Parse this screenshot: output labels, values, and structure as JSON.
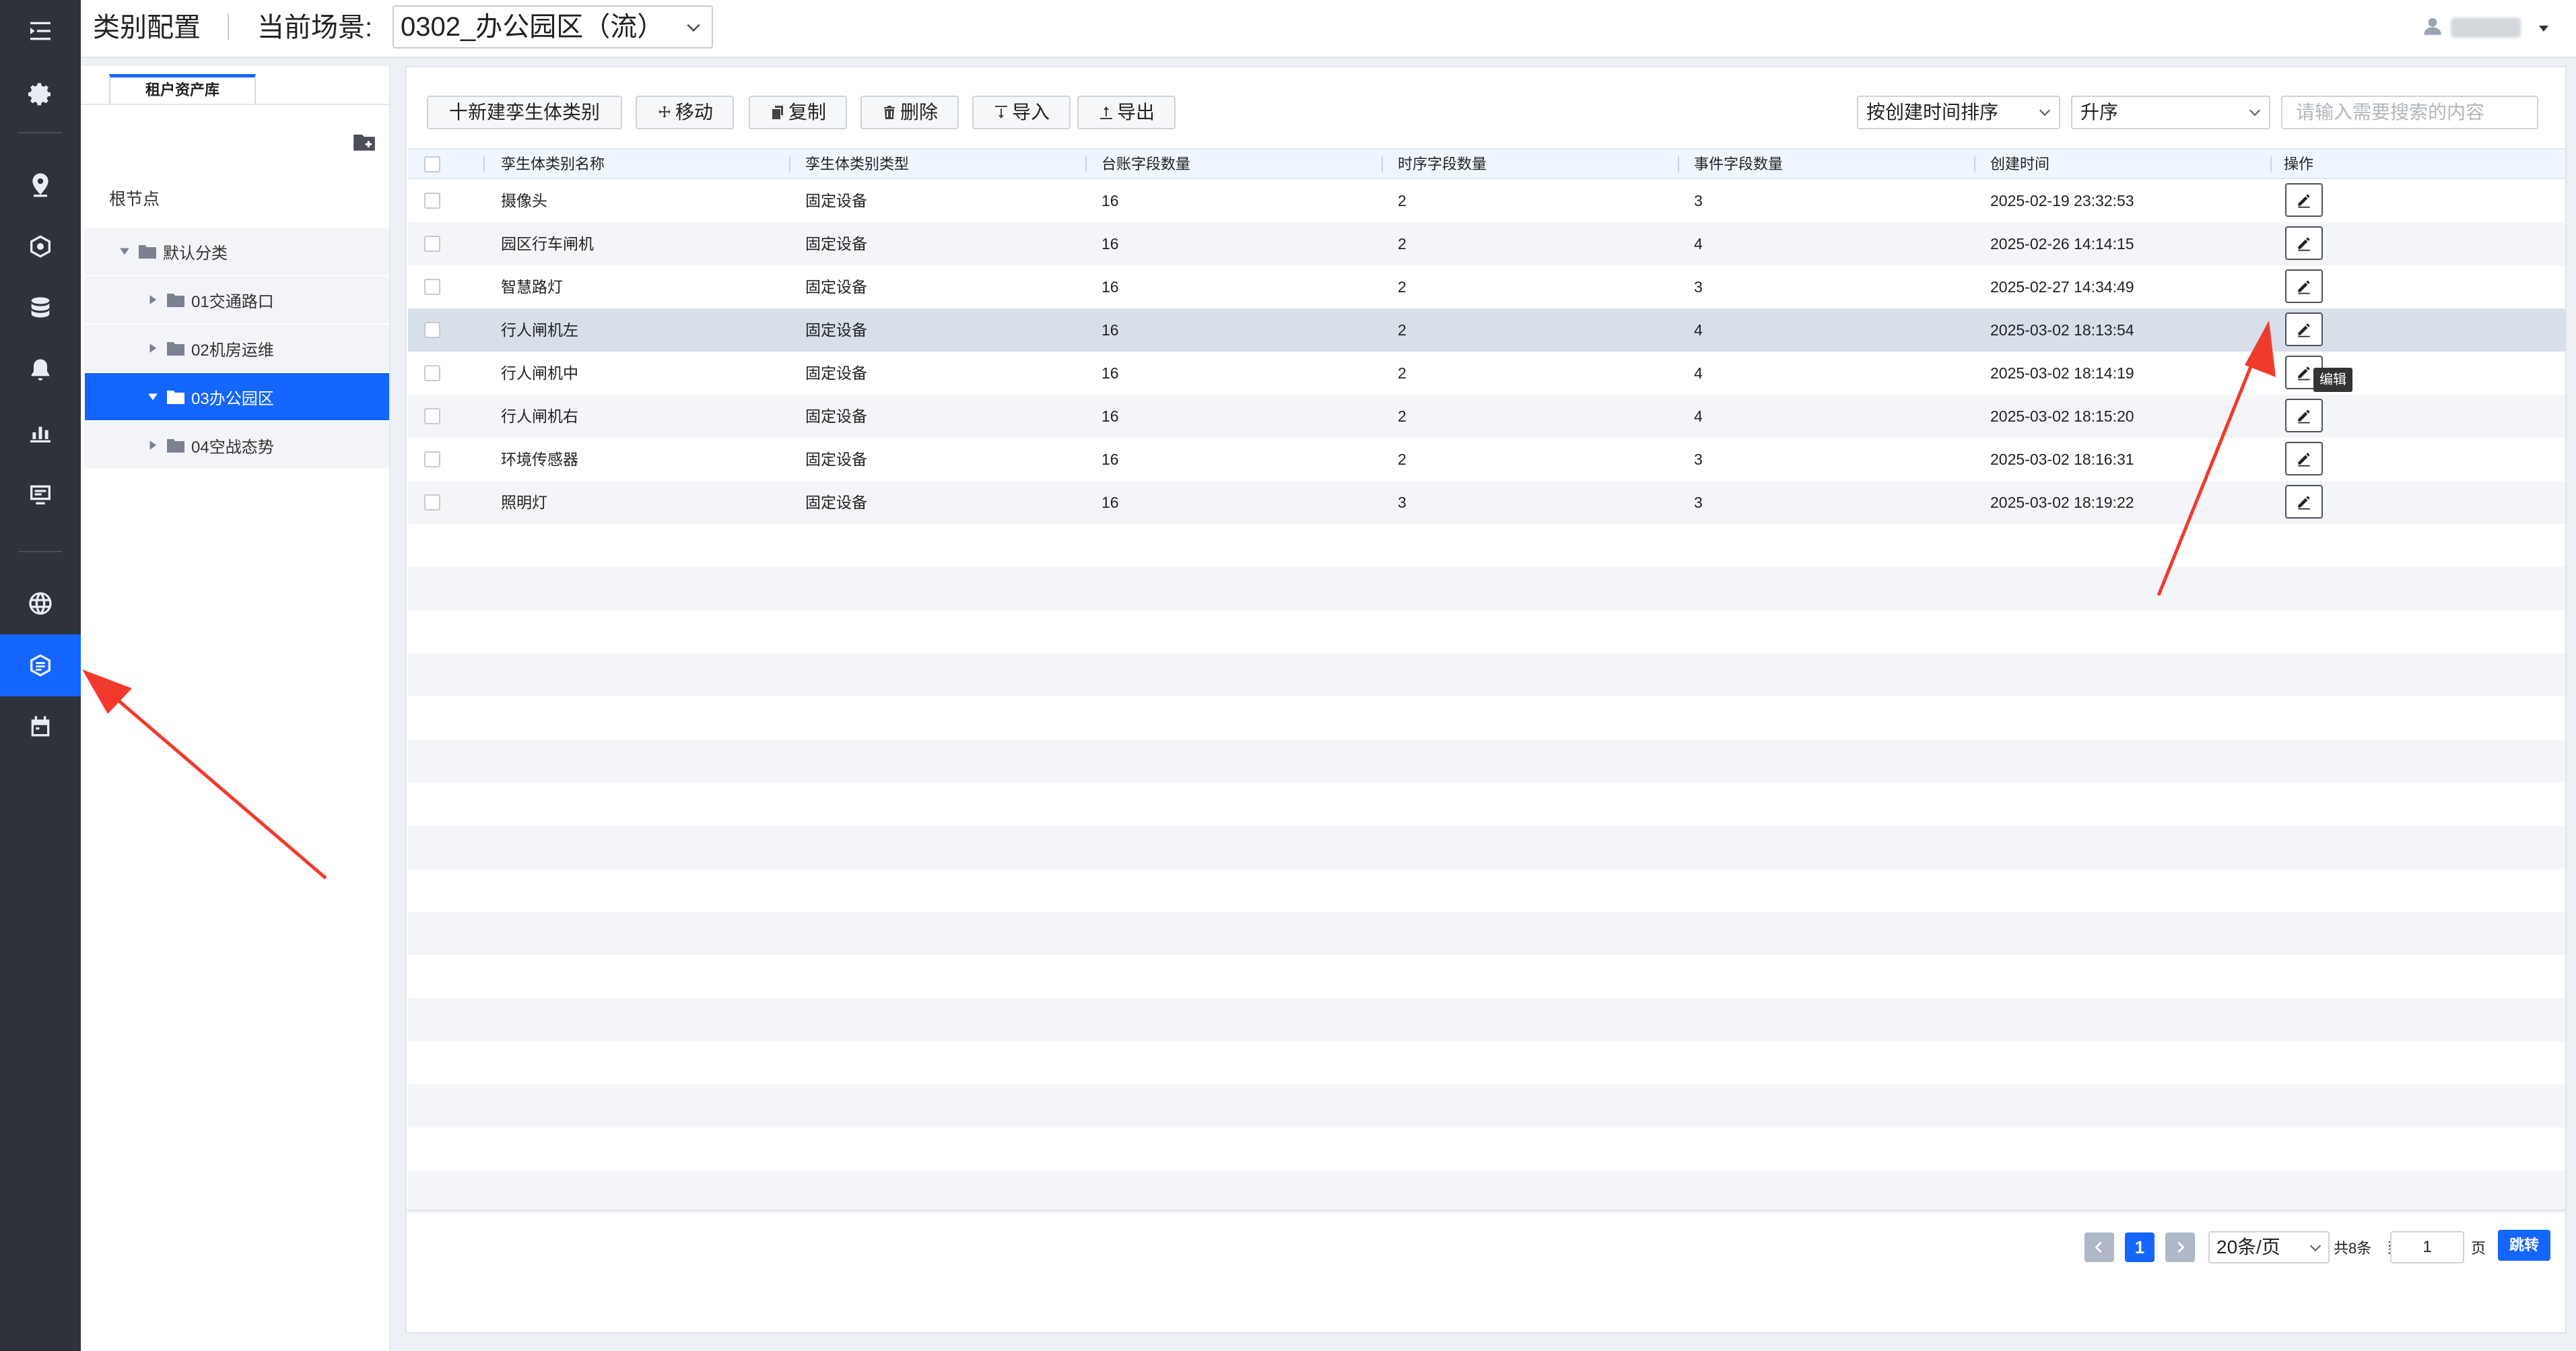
{
  "header": {
    "page_title": "类别配置",
    "scene_label": "当前场景:",
    "scene_value": "0302_办公园区（流）"
  },
  "sidebar": {
    "icons": [
      "menu-toggle-icon",
      "gear-icon",
      "location-pin-icon",
      "cube-gear-icon",
      "database-icon",
      "bell-icon",
      "bar-chart-icon",
      "monitor-icon",
      "globe-icon",
      "category-config-icon",
      "calendar-icon"
    ],
    "active": "category-config-icon"
  },
  "tree": {
    "tab": "租户资产库",
    "root": "根节点",
    "nodes": [
      {
        "label": "默认分类",
        "expanded": true
      },
      {
        "label": "01交通路口",
        "expanded": false
      },
      {
        "label": "02机房运维",
        "expanded": false
      },
      {
        "label": "03办公园区",
        "expanded": true,
        "selected": true
      },
      {
        "label": "04空战态势",
        "expanded": false
      }
    ]
  },
  "toolbar": {
    "new_label": "十新建孪生体类别",
    "move_label": "移动",
    "copy_label": "复制",
    "delete_label": "删除",
    "import_label": "导入",
    "export_label": "导出",
    "sort_value": "按创建时间排序",
    "order_value": "升序",
    "search_placeholder": "请输入需要搜索的内容"
  },
  "table": {
    "headers": [
      "孪生体类别名称",
      "孪生体类别类型",
      "台账字段数量",
      "时序字段数量",
      "事件字段数量",
      "创建时间",
      "操作"
    ],
    "rows": [
      {
        "name": "摄像头",
        "type": "固定设备",
        "ledger": "16",
        "timeseries": "2",
        "event": "3",
        "created": "2025-02-19 23:32:53"
      },
      {
        "name": "园区行车闸机",
        "type": "固定设备",
        "ledger": "16",
        "timeseries": "2",
        "event": "4",
        "created": "2025-02-26 14:14:15"
      },
      {
        "name": "智慧路灯",
        "type": "固定设备",
        "ledger": "16",
        "timeseries": "2",
        "event": "3",
        "created": "2025-02-27 14:34:49"
      },
      {
        "name": "行人闸机左",
        "type": "固定设备",
        "ledger": "16",
        "timeseries": "2",
        "event": "4",
        "created": "2025-03-02 18:13:54"
      },
      {
        "name": "行人闸机中",
        "type": "固定设备",
        "ledger": "16",
        "timeseries": "2",
        "event": "4",
        "created": "2025-03-02 18:14:19"
      },
      {
        "name": "行人闸机右",
        "type": "固定设备",
        "ledger": "16",
        "timeseries": "2",
        "event": "4",
        "created": "2025-03-02 18:15:20"
      },
      {
        "name": "环境传感器",
        "type": "固定设备",
        "ledger": "16",
        "timeseries": "2",
        "event": "3",
        "created": "2025-03-02 18:16:31"
      },
      {
        "name": "照明灯",
        "type": "固定设备",
        "ledger": "16",
        "timeseries": "3",
        "event": "3",
        "created": "2025-03-02 18:19:22"
      }
    ],
    "tooltip": "编辑"
  },
  "pagination": {
    "current_page": "1",
    "page_size": "20条/页",
    "total": "共8条",
    "goto_label": "到",
    "goto_value": "1",
    "page_unit": "页",
    "jump_label": "跳转"
  },
  "colors": {
    "accent": "#1565ff",
    "sidebar_bg": "#2e323b",
    "annotation": "#f23a2c"
  }
}
